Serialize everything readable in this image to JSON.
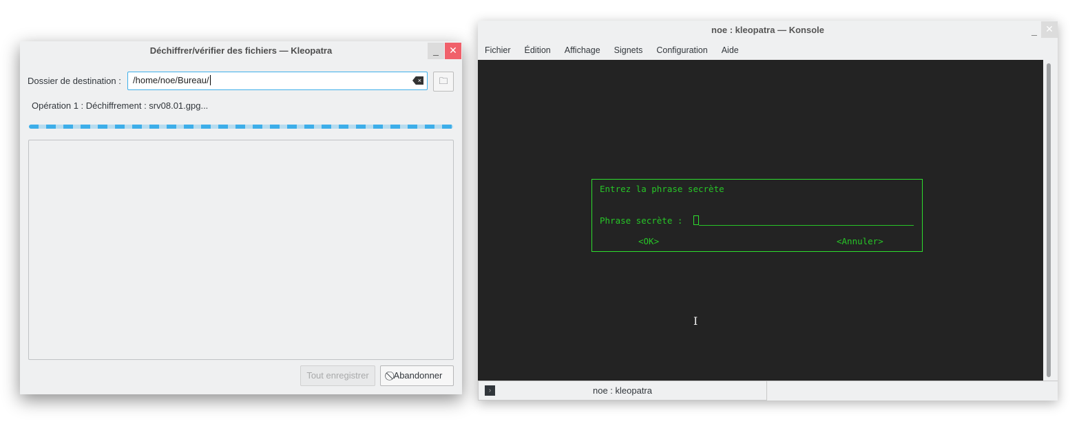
{
  "kleopatra": {
    "title": "Déchiffrer/vérifier des fichiers — Kleopatra",
    "minimize": "_",
    "close": "✕",
    "dest_label": "Dossier de destination :",
    "dest_value": "/home/noe/Bureau/",
    "browse_icon": "folder-icon",
    "operation": "Opération 1 : Déchiffrement : srv08.01.gpg...",
    "progress": "indeterminate",
    "save_all": "Tout enregistrer",
    "abort": "Abandonner",
    "accent": "#3daee9"
  },
  "konsole": {
    "title": "noe : kleopatra — Konsole",
    "minimize": "_",
    "close": "✕",
    "menu": [
      "Fichier",
      "Édition",
      "Affichage",
      "Signets",
      "Configuration",
      "Aide"
    ],
    "dialog": {
      "title": "Entrez la phrase secrète",
      "label": "Phrase secrète :",
      "ok": "<OK>",
      "cancel": "<Annuler>",
      "color": "#27c627"
    },
    "tab": "noe : kleopatra"
  }
}
